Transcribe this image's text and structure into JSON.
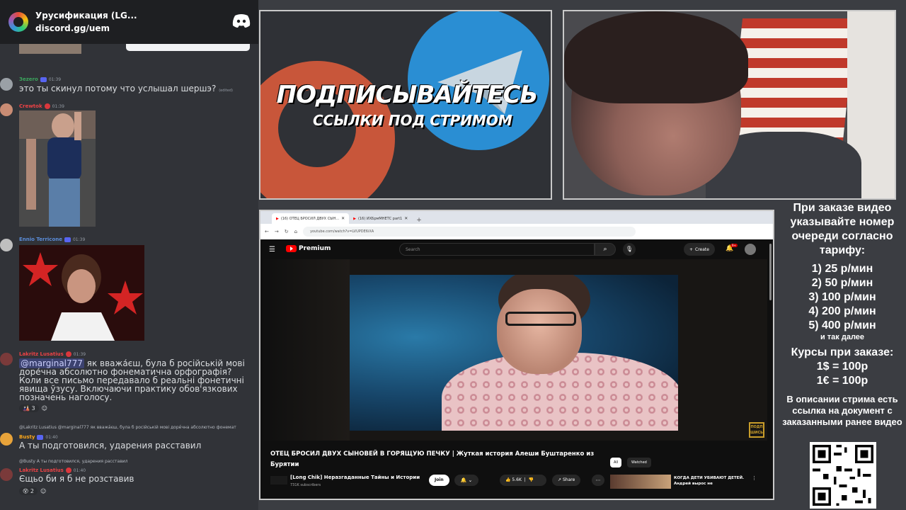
{
  "discord": {
    "server_name": "Урусификация (LG...",
    "server_link": "discord.gg/uem",
    "messages": [
      {
        "user": "Зezero",
        "time": "01:39",
        "text": "это ты скинул потому что услышал шершэ?",
        "edited": "(edited)",
        "name_color": "#3ba55d"
      },
      {
        "user": "Crewtok",
        "time": "01:39",
        "name_color": "#ed4245"
      },
      {
        "user": "Ennio Terricone",
        "time": "01:39",
        "name_color": "#5865f2"
      },
      {
        "user": "Lakritz Lusatius",
        "time": "01:39",
        "mention": "@marginal777",
        "text": " як вважа́єш, була б російській мові доре́чна абсолютно фонематична орфографія? Коли все письмо передавало б реальні фонетичні явища ўзусу. Включаючи практику обов'язкових позначень наголосу.",
        "reaction_count": "3",
        "name_color": "#ed4245"
      },
      {
        "user": "Busty",
        "time": "01:40",
        "reply": "@Lakritz Lusatius @marginal777 як вважа́єш, була б російській мові доре́чна абсолютно фонемат",
        "text": "А ты подготовился, ударения расставил",
        "name_color": "#faa61a"
      },
      {
        "user": "Lakritz Lusatius",
        "time": "01:40",
        "reply": "@Busty А ты подготовился, ударения расставил",
        "text": "Єщьо би я б не розставив",
        "reaction_count": "2",
        "name_color": "#ed4245"
      }
    ]
  },
  "promo": {
    "title": "ПОДПИСЫВАЙТЕСЬ",
    "subtitle": "ССЫЛКИ ПОД СТРИМОМ"
  },
  "info": {
    "order_text": "При заказе видео указывайте номер очереди согласно тарифу:",
    "tariffs": [
      "1) 25 р/мин",
      "2) 50 р/мин",
      "3) 100 р/мин",
      "4) 200 р/мин",
      "5) 400 р/мин"
    ],
    "etc": "и так далее",
    "rates_title": "Курсы при заказе:",
    "rates": [
      "1$ = 100р",
      "1€ = 100р"
    ],
    "desc": "В описании стрима есть ссылка на документ с заказанными ранее видео"
  },
  "browser": {
    "tabs": [
      "(16) ОТЕЦ БРОСИЛ ДВУХ СЫН...",
      "(16) ИХБрмМНЕТС part1"
    ],
    "url": "youtube.com/watch?v=LVUPDE6iXA"
  },
  "youtube": {
    "brand": "Premium",
    "search_placeholder": "Search",
    "create_label": "Create",
    "notif_count": "9+",
    "video_title": "ОТЕЦ БРОСИЛ ДВУХ СЫНОВЕЙ В ГОРЯЩУЮ ПЕЧКУ | Жуткая история Алеши Буштаренко из Бурятии",
    "channel_name": "[Long Chik] Неразгаданные Тайны и Истории",
    "subscribers": "731K subscribers",
    "join_label": "Join",
    "likes": "5.6K",
    "share_label": "Share",
    "chip_all": "All",
    "chip_watched": "Watched",
    "rec_title": "КОГДА ДЕТИ УБИВАЮТ ДЕТЕЙ. Андрей вырос не",
    "watermark": "ПОДП ШИСЬ"
  }
}
